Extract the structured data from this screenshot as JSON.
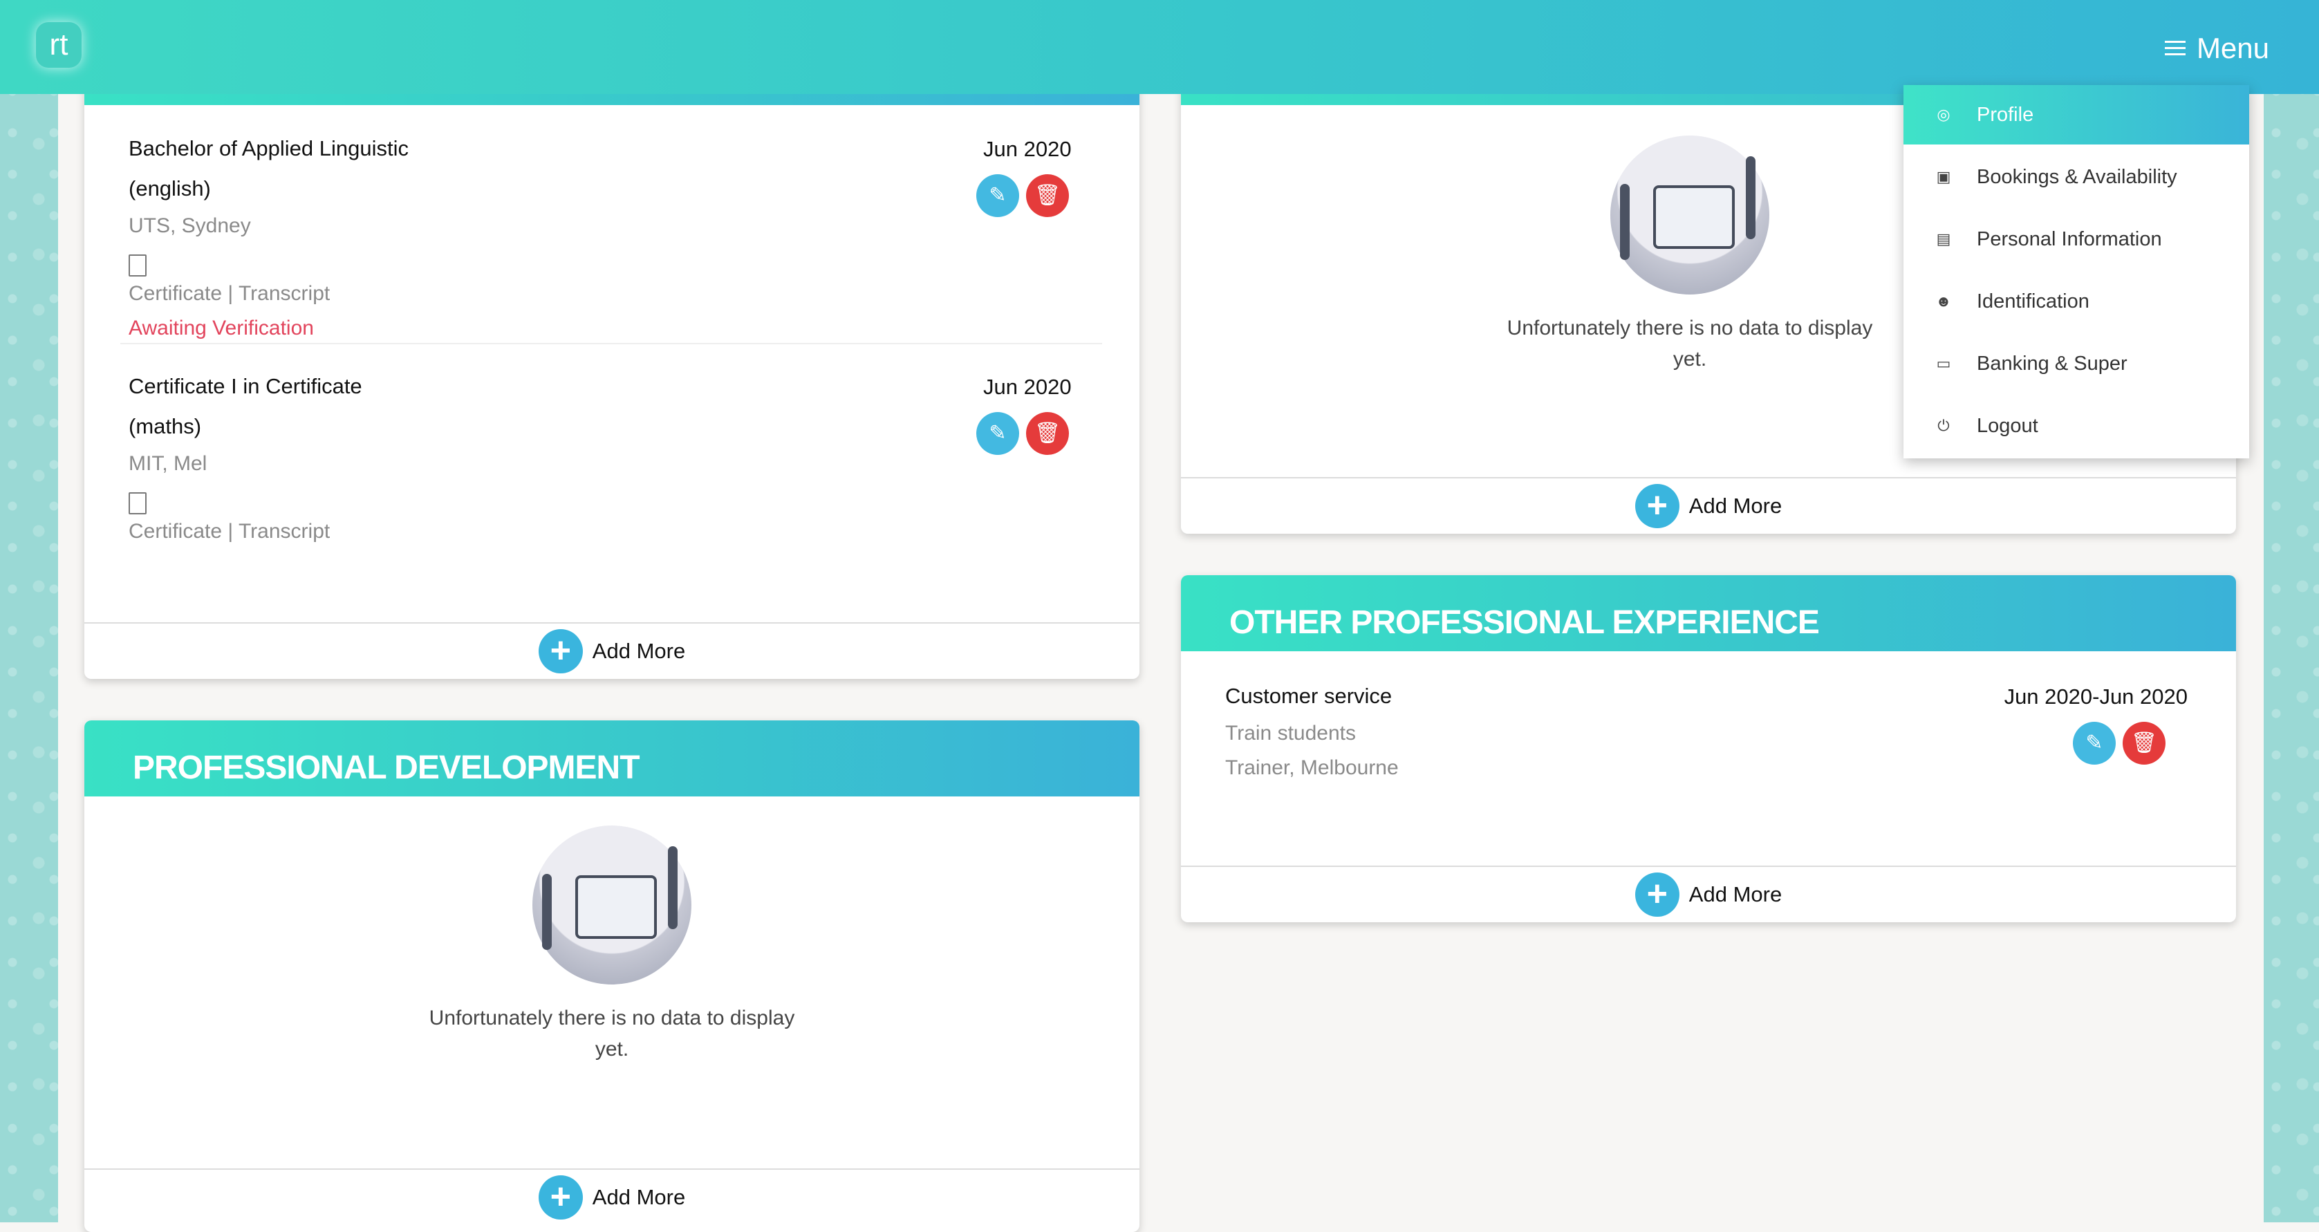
{
  "header": {
    "logo_text": "rt",
    "menu_label": "Menu"
  },
  "dropdown": {
    "items": [
      {
        "label": "Profile",
        "icon": "user-circle-icon",
        "active": true
      },
      {
        "label": "Bookings & Availability",
        "icon": "calendar-check-icon"
      },
      {
        "label": "Personal Information",
        "icon": "id-card-icon"
      },
      {
        "label": "Identification",
        "icon": "user-check-icon"
      },
      {
        "label": "Banking & Super",
        "icon": "credit-card-icon"
      },
      {
        "label": "Logout",
        "icon": "power-icon"
      }
    ]
  },
  "education": {
    "entries": [
      {
        "title_line1": "Bachelor of Applied Linguistic",
        "title_line2": "(english)",
        "institution": "UTS, Sydney",
        "documents": "Certificate  | Transcript",
        "status": "Awaiting Verification",
        "date": "Jun 2020"
      },
      {
        "title_line1": "Certificate I in Certificate",
        "title_line2": "(maths)",
        "institution": "MIT, Mel",
        "documents": "Certificate  | Transcript",
        "date": "Jun 2020"
      }
    ],
    "add_more": "Add More"
  },
  "professional_development": {
    "title": "PROFESSIONAL DEVELOPMENT",
    "empty_line1": "Unfortunately there is no data to display",
    "empty_line2": "yet.",
    "add_more": "Add More"
  },
  "top_right_card": {
    "empty_line1": "Unfortunately there is no data to display",
    "empty_line2": "yet.",
    "add_more": "Add More"
  },
  "other_experience": {
    "title": "OTHER PROFESSIONAL EXPERIENCE",
    "entries": [
      {
        "title": "Customer service",
        "role": "Train students",
        "location": "Trainer, Melbourne",
        "date": "Jun 2020-Jun 2020"
      }
    ],
    "add_more": "Add More"
  },
  "colors": {
    "accent_start": "#3fd8c4",
    "accent_end": "#36b4d6",
    "edit": "#43b9e1",
    "delete": "#e53b3b",
    "warning_text": "#e2445c"
  }
}
